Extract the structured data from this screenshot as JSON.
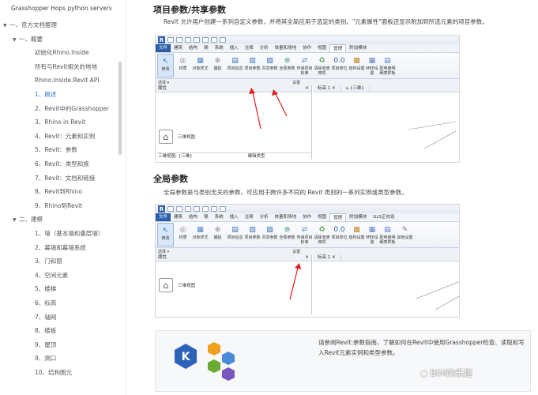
{
  "sidebar": {
    "top": "Grasshopper Hops python servers",
    "items": [
      {
        "label": "一、官方文档整理",
        "level": 0,
        "caret": "▼"
      },
      {
        "label": "一、概要",
        "level": 1,
        "caret": "▼"
      },
      {
        "label": "初始化Rhino.Inside",
        "level": 2
      },
      {
        "label": "所有与Revit相关的地地",
        "level": 2
      },
      {
        "label": "Rhino.Inside.Revit API",
        "level": 2
      },
      {
        "label": "1、概述",
        "level": 2,
        "active": true
      },
      {
        "label": "2、Revit中的Grasshopper",
        "level": 2
      },
      {
        "label": "3、Rhino in Revit",
        "level": 2
      },
      {
        "label": "4、Revit：元素和实例",
        "level": 2
      },
      {
        "label": "5、Revit：参数",
        "level": 2
      },
      {
        "label": "6、Revit：类型和族",
        "level": 2
      },
      {
        "label": "7、Revit：文档和链接",
        "level": 2
      },
      {
        "label": "8、Revit到Rhino",
        "level": 2
      },
      {
        "label": "9、Rhino到Revit",
        "level": 2
      },
      {
        "label": "二、建模",
        "level": 1,
        "caret": "▼"
      },
      {
        "label": "1、墙（基本墙和叠层墙）",
        "level": 2
      },
      {
        "label": "2、幕墙和幕墙系统",
        "level": 2
      },
      {
        "label": "3、门和窗",
        "level": 2
      },
      {
        "label": "4、空间元素",
        "level": 2
      },
      {
        "label": "5、楼梯",
        "level": 2
      },
      {
        "label": "6、标高",
        "level": 2
      },
      {
        "label": "7、轴网",
        "level": 2
      },
      {
        "label": "8、楼板",
        "level": 2
      },
      {
        "label": "9、屋顶",
        "level": 2
      },
      {
        "label": "9、洞口",
        "level": 2
      },
      {
        "label": "10、结构图元",
        "level": 2
      }
    ]
  },
  "section1": {
    "title": "项目参数/共享参数",
    "desc": "Revit 允许用户创建一系列自定义参数，并将其全局应用于选定的类别。\"元素属性\"面板还显示附加到所选元素的项目参数。"
  },
  "section2": {
    "title": "全局参数",
    "desc": "全局参数是与类别无关的参数，可应用于跨许多不同的 Revit 类别的一系列实例或类型参数。"
  },
  "revit": {
    "logo": "R",
    "menu": [
      "文件",
      "建筑",
      "结构",
      "钢",
      "系统",
      "插入",
      "注释",
      "分析",
      "体量和场地",
      "协作",
      "视图",
      "管理",
      "附加模块"
    ],
    "menu2": [
      "文件",
      "建筑",
      "结构",
      "钢",
      "系统",
      "插入",
      "注释",
      "分析",
      "体量和场地",
      "协作",
      "视图",
      "管理",
      "附加模块",
      "GLS正向设"
    ],
    "selected_menu": "管理",
    "tools": [
      {
        "label": "修改",
        "icon": "↖"
      },
      {
        "label": "材质",
        "icon": "◎"
      },
      {
        "label": "对象样式",
        "icon": "▦"
      },
      {
        "label": "捕捉",
        "icon": "⊕"
      },
      {
        "label": "项目信息",
        "icon": "▤"
      },
      {
        "label": "项目参数",
        "icon": "▥"
      },
      {
        "label": "共享参数",
        "icon": "▧"
      },
      {
        "label": "全局参数",
        "icon": "⊜"
      },
      {
        "label": "传递项目标准",
        "icon": "⇄"
      },
      {
        "label": "清除未使用项",
        "icon": "♻"
      },
      {
        "label": "项目单位",
        "icon": "0.0"
      },
      {
        "label": "结构设置",
        "icon": "▩"
      },
      {
        "label": "MEP设置",
        "icon": "▦"
      },
      {
        "label": "配电盘明细表样板",
        "icon": "▤"
      },
      {
        "label": "其他设置",
        "icon": "✎"
      }
    ],
    "ribbon_select": "选择 ▾",
    "ribbon_settings": "设置",
    "props_title": "属性",
    "props_type": "三维视图",
    "props_footer": "三维视图: {三维}",
    "edit_type": "编辑类型",
    "view_tab1": "标高 1",
    "view_tab2": "{三维}",
    "close": "✕"
  },
  "info": {
    "text": "请参阅Revit:参数指南，了解如何在Revit中使用Grasshopper检查、读取和写入Revit元素实例和类型参数。",
    "logo_letter": "K"
  },
  "watermark": "BIM的乐趣"
}
